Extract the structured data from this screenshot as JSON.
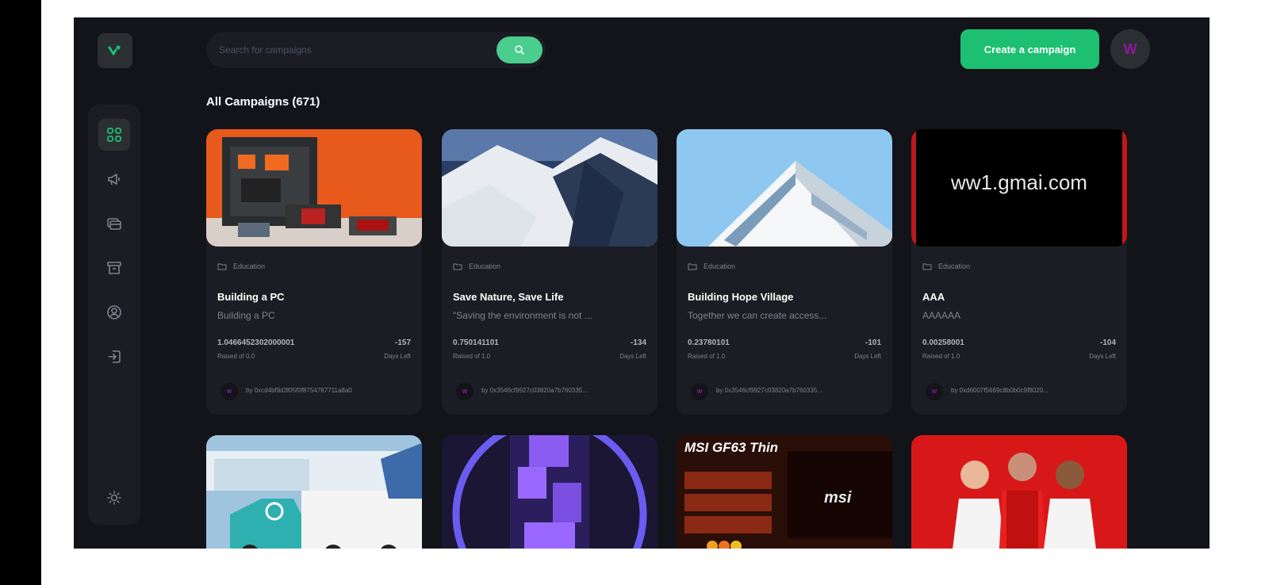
{
  "brand": {
    "logo_icon": "app-logo-icon"
  },
  "sidebar": {
    "items": [
      {
        "name": "dashboard",
        "icon": "dashboard-icon",
        "active": true
      },
      {
        "name": "campaign",
        "icon": "megaphone-icon"
      },
      {
        "name": "payment",
        "icon": "payment-icon"
      },
      {
        "name": "withdraw",
        "icon": "withdraw-icon"
      },
      {
        "name": "profile",
        "icon": "profile-icon"
      },
      {
        "name": "logout",
        "icon": "logout-icon"
      }
    ],
    "theme_icon": "sun-icon"
  },
  "search": {
    "placeholder": "Search for campaigns"
  },
  "header": {
    "create_label": "Create a campaign",
    "avatar_text": "W"
  },
  "section": {
    "title": "All Campaigns (671)"
  },
  "campaigns": [
    {
      "category": "Education",
      "title": "Building a PC",
      "description": "Building a PC",
      "raised": "1.0466452302000001",
      "raised_label": "Raised of 0.0",
      "days": "-157",
      "days_label": "Days Left",
      "owner": "by 0xcd4bf9d3f05f0f8754787711a8a0"
    },
    {
      "category": "Education",
      "title": "Save Nature, Save Life",
      "description": "\"Saving the environment is not ...",
      "raised": "0.750141101",
      "raised_label": "Raised of 1.0",
      "days": "-134",
      "days_label": "Days Left",
      "owner": "by 0x3546cf9927c03820a7b760335..."
    },
    {
      "category": "Education",
      "title": "Building Hope Village",
      "description": "Together we can create access...",
      "raised": "0.23780101",
      "raised_label": "Raised of 1.0",
      "days": "-101",
      "days_label": "Days Left",
      "owner": "by 0x3546cf9927c03820a7b760335..."
    },
    {
      "category": "Education",
      "title": "AAA",
      "description": "AAAAAA",
      "raised": "0.00258001",
      "raised_label": "Raised of 1.0",
      "days": "-104",
      "days_label": "Days Left",
      "owner": "by 0xd6007f5669c8b0b0c9f8020..."
    }
  ],
  "card_image_text": {
    "domain_text": "ww1.gmai.com",
    "laptop_title": "MSI GF63 Thin",
    "laptop_brand": "msi"
  },
  "colors": {
    "bg": "#13131a",
    "card": "#1c1c24",
    "accent": "#1dc071",
    "search_btn": "#4acd8d",
    "avatar": "#8c1a9a"
  }
}
